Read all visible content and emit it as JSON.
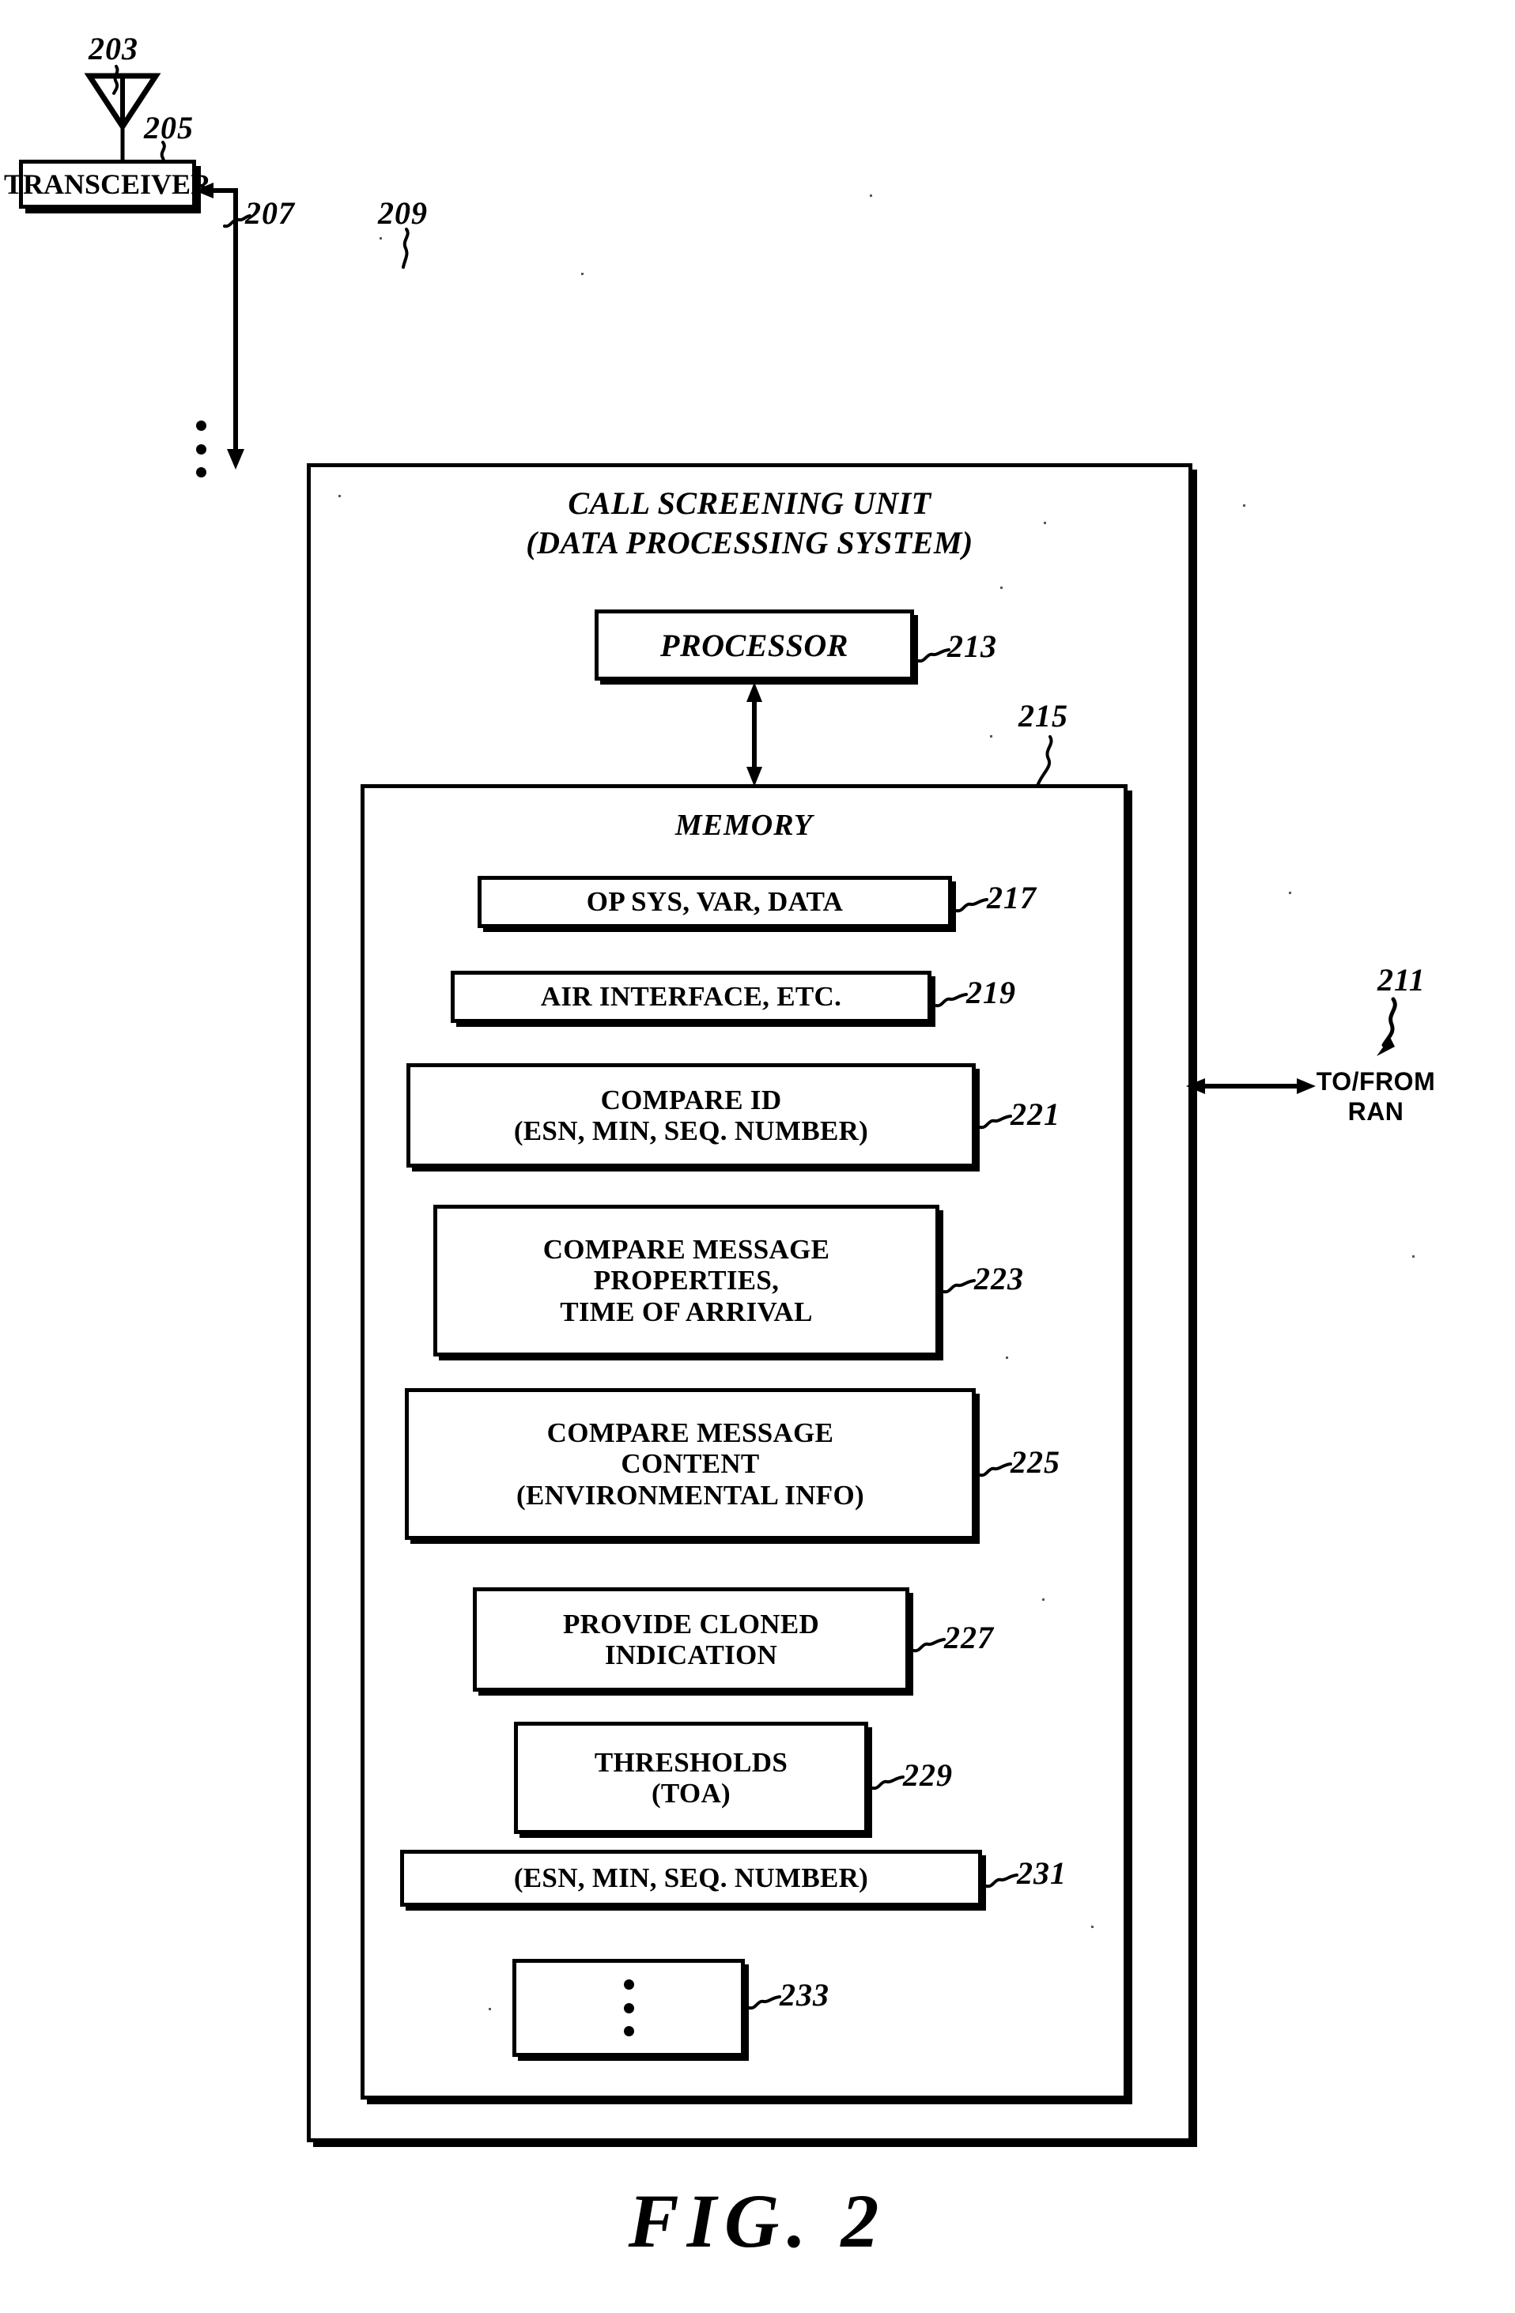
{
  "figure": {
    "caption": "FIG. 2",
    "antenna_ref": "203",
    "transceiver_label": "TRANSCEIVER",
    "transceiver_ref": "205",
    "link_ref": "207",
    "unit_ref": "209",
    "ran_ref": "211",
    "ran_label": "TO/FROM\nRAN",
    "unit_title": "CALL SCREENING UNIT\n(DATA PROCESSING SYSTEM)",
    "processor_label": "PROCESSOR",
    "processor_ref": "213",
    "memory_label": "MEMORY",
    "memory_ref": "215",
    "ellipsis": "⋮"
  },
  "memory_blocks": [
    {
      "ref": "217",
      "label": "OP SYS, VAR, DATA"
    },
    {
      "ref": "219",
      "label": "AIR INTERFACE, ETC."
    },
    {
      "ref": "221",
      "label": "COMPARE ID\n(ESN, MIN, SEQ. NUMBER)"
    },
    {
      "ref": "223",
      "label": "COMPARE MESSAGE\nPROPERTIES,\nTIME OF ARRIVAL"
    },
    {
      "ref": "225",
      "label": "COMPARE MESSAGE\nCONTENT\n(ENVIRONMENTAL INFO)"
    },
    {
      "ref": "227",
      "label": "PROVIDE CLONED\nINDICATION"
    },
    {
      "ref": "229",
      "label": "THRESHOLDS\n(TOA)"
    },
    {
      "ref": "231",
      "label": "(ESN, MIN, SEQ. NUMBER)"
    },
    {
      "ref": "233",
      "label": ""
    }
  ]
}
